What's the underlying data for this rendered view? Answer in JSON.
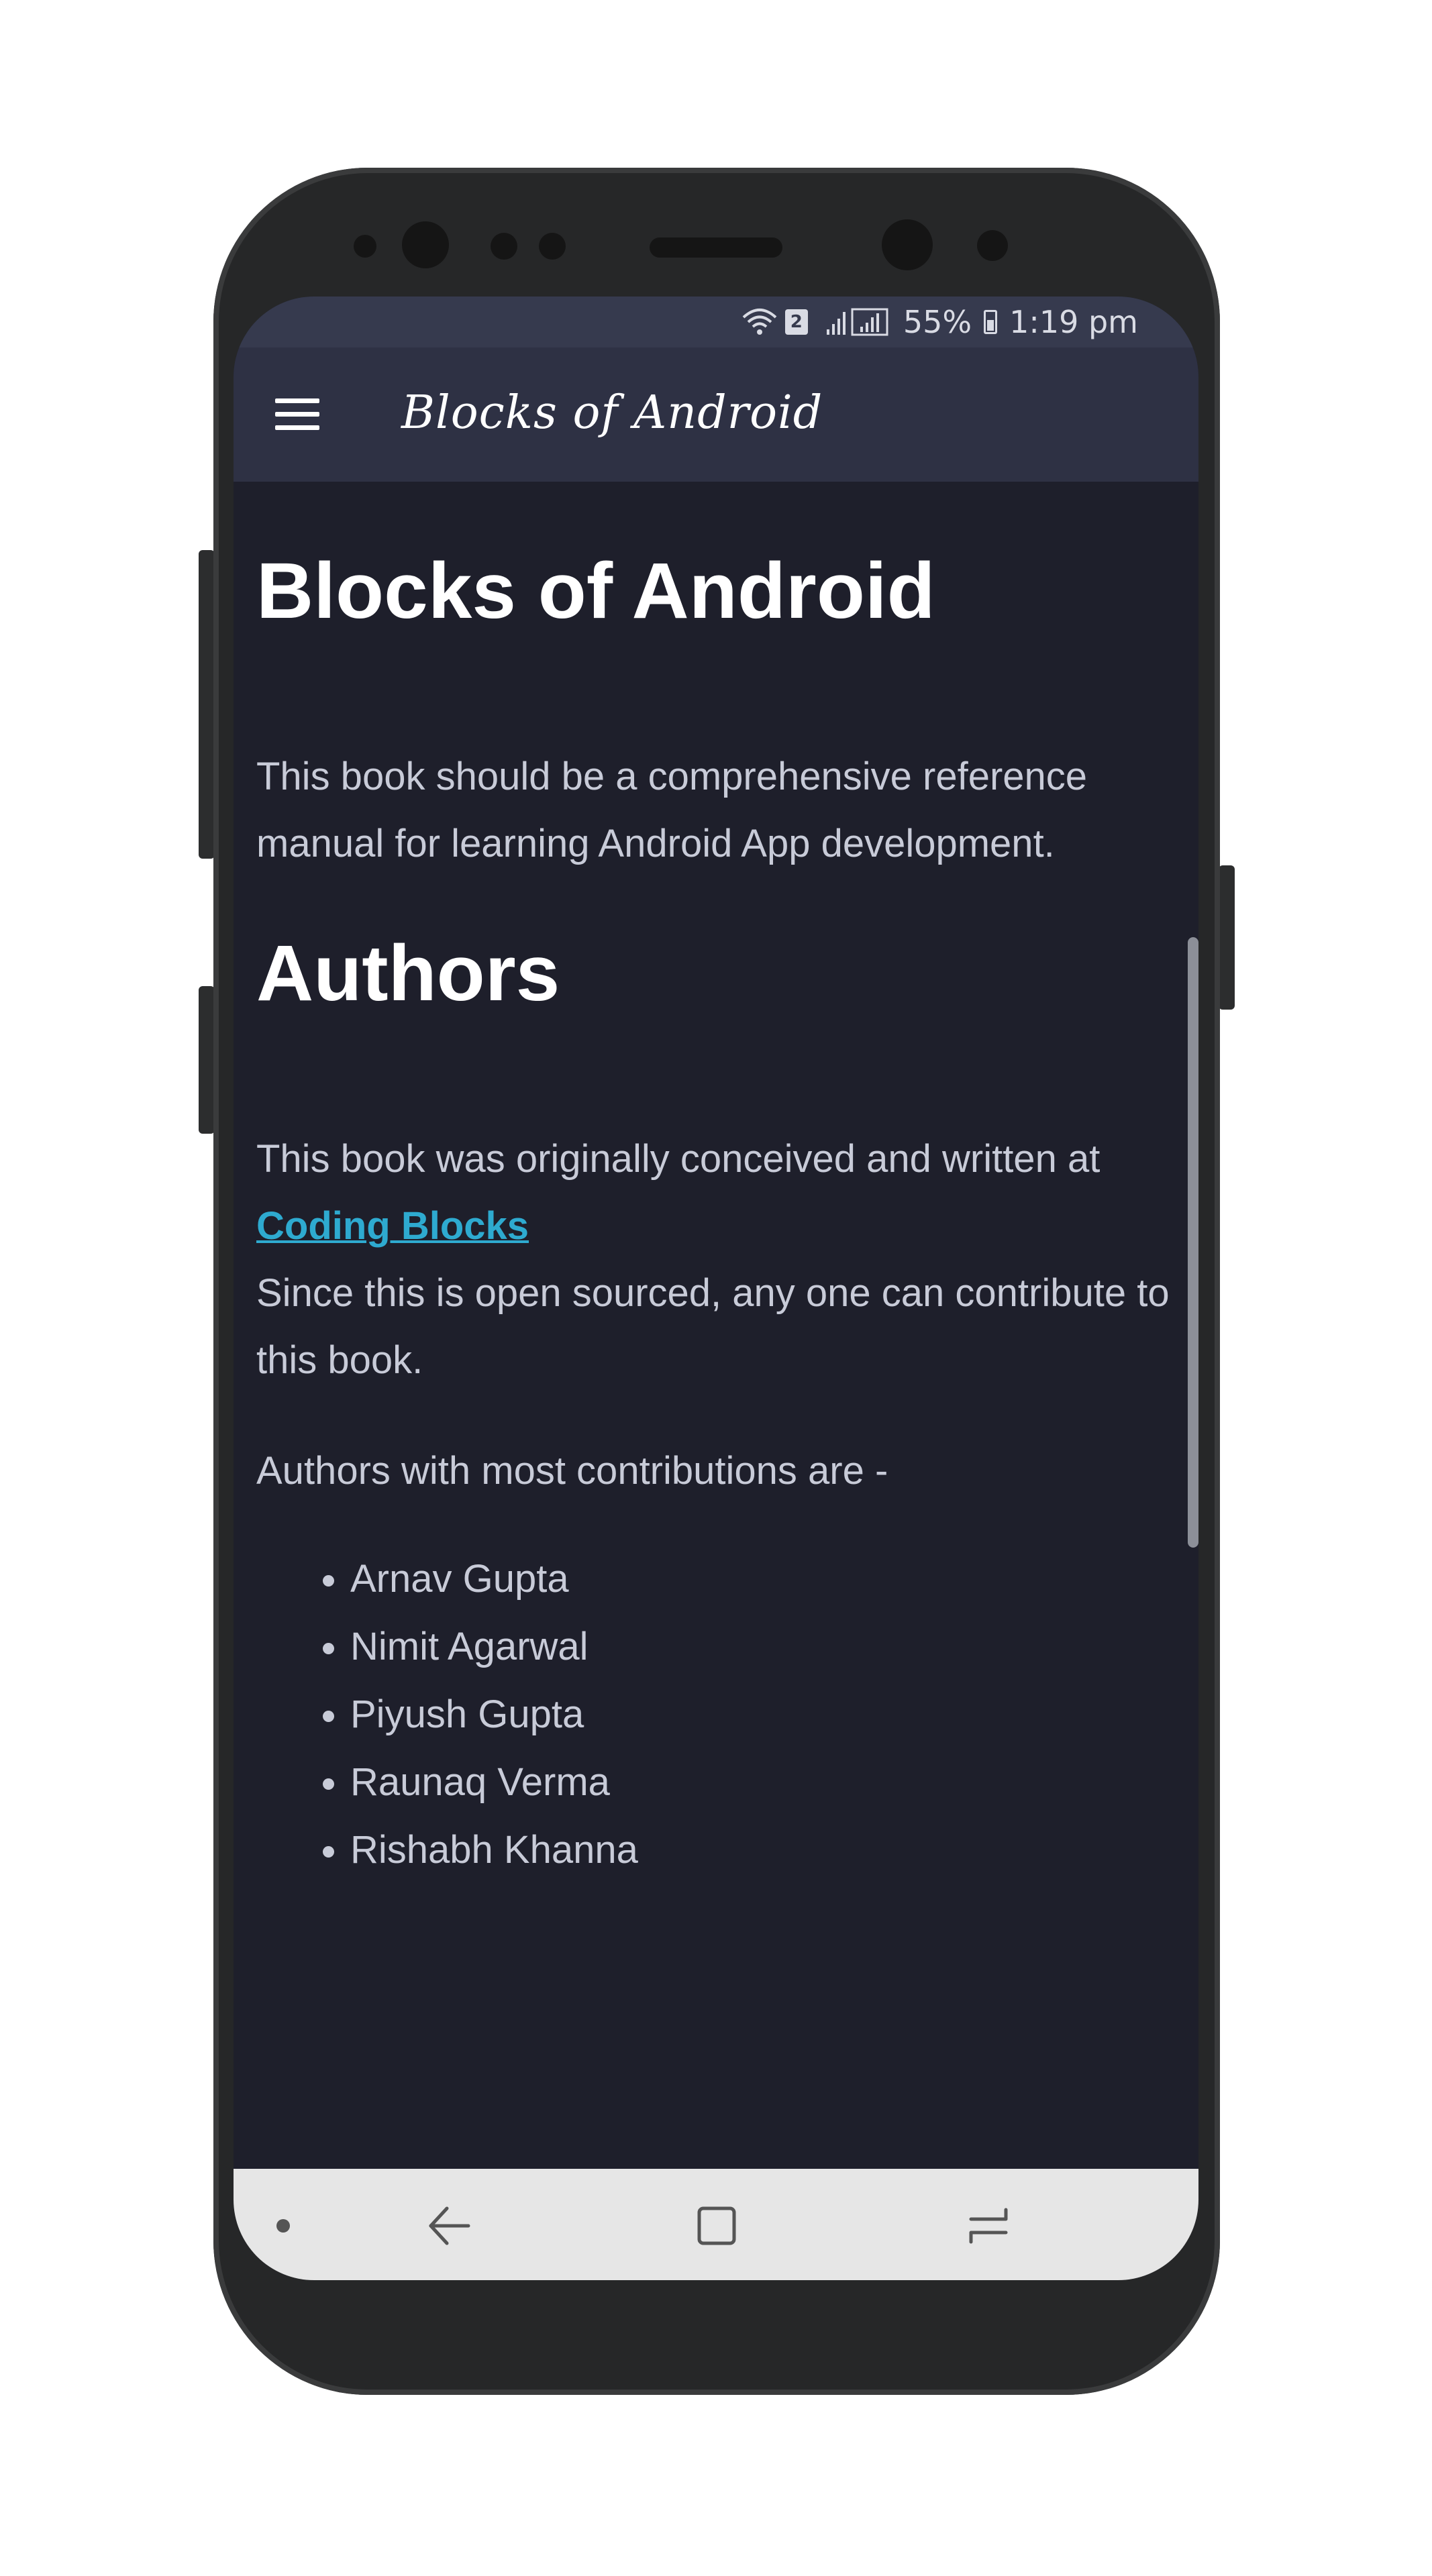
{
  "status_bar": {
    "sim": "2",
    "battery_percent": "55%",
    "time": "1:19 pm"
  },
  "toolbar": {
    "title": "Blocks of Android"
  },
  "article": {
    "heading_main": "Blocks of Android",
    "intro": "This book should be a comprehensive reference manual for learning Android App development.",
    "heading_authors": "Authors",
    "conceived_text": "This book was originally conceived and written at",
    "link_label": "Coding Blocks",
    "open_source_text": "Since this is open sourced, any one can contribute to this book.",
    "contributions_intro": "Authors with most contributions are -",
    "authors": [
      "Arnav Gupta",
      "Nimit Agarwal",
      "Piyush Gupta",
      "Raunaq Verma",
      "Rishabh Khanna"
    ]
  },
  "colors": {
    "background": "#1e1f2b",
    "toolbar": "#2e3144",
    "link": "#2eaad0"
  },
  "icons": {
    "menu": "hamburger-icon",
    "wifi": "wifi-icon",
    "signal": "signal-icon",
    "battery": "battery-icon",
    "back": "back-icon",
    "home": "home-icon",
    "recents": "recents-icon"
  }
}
